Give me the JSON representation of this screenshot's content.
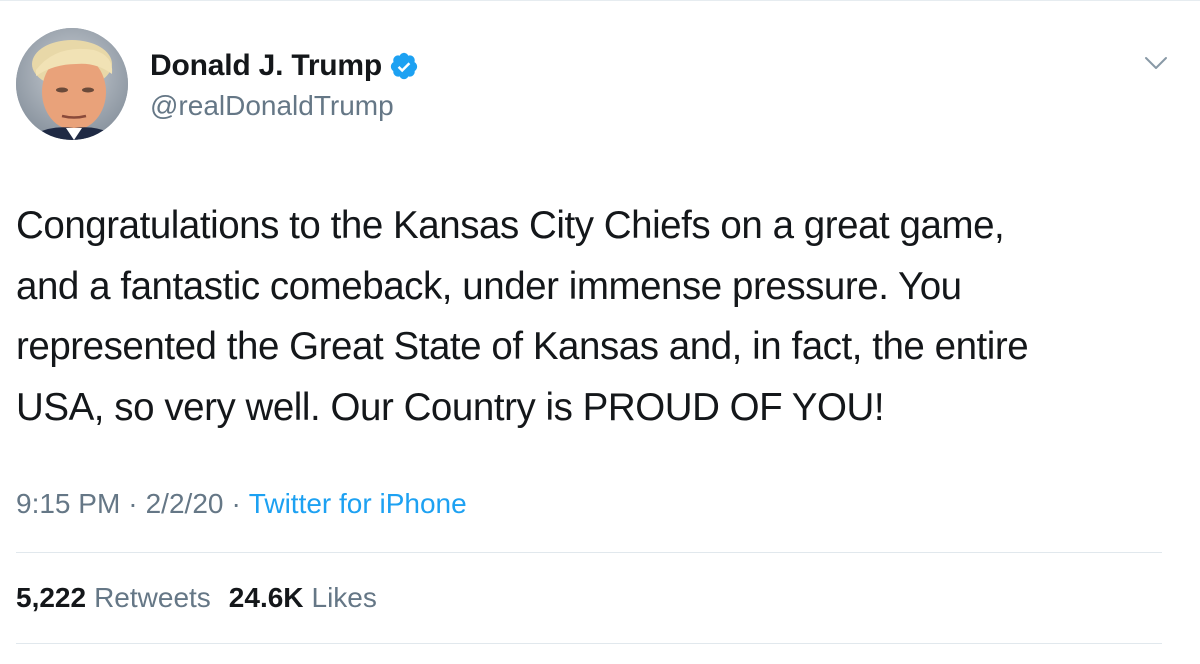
{
  "author": {
    "display_name": "Donald J. Trump",
    "handle": "@realDonaldTrump",
    "verified": true,
    "avatar_icon": "profile-photo"
  },
  "tweet": {
    "lines": [
      "Congratulations to the Kansas City Chiefs on a great game,",
      "and a fantastic comeback, under immense pressure. You",
      "represented the Great State of Kansas and, in fact, the entire",
      "USA, so very well. Our Country is PROUD OF YOU!"
    ]
  },
  "meta": {
    "time": "9:15 PM",
    "separator": "·",
    "date": "2/2/20",
    "source": "Twitter for iPhone"
  },
  "stats": {
    "retweets_count": "5,222",
    "retweets_label": "Retweets",
    "likes_count": "24.6K",
    "likes_label": "Likes"
  },
  "colors": {
    "text_primary": "#14171a",
    "text_secondary": "#657786",
    "accent": "#1da1f2",
    "divider": "#e1e8ed"
  },
  "icons": {
    "verified": "verified-badge-icon",
    "more": "chevron-down-icon"
  }
}
